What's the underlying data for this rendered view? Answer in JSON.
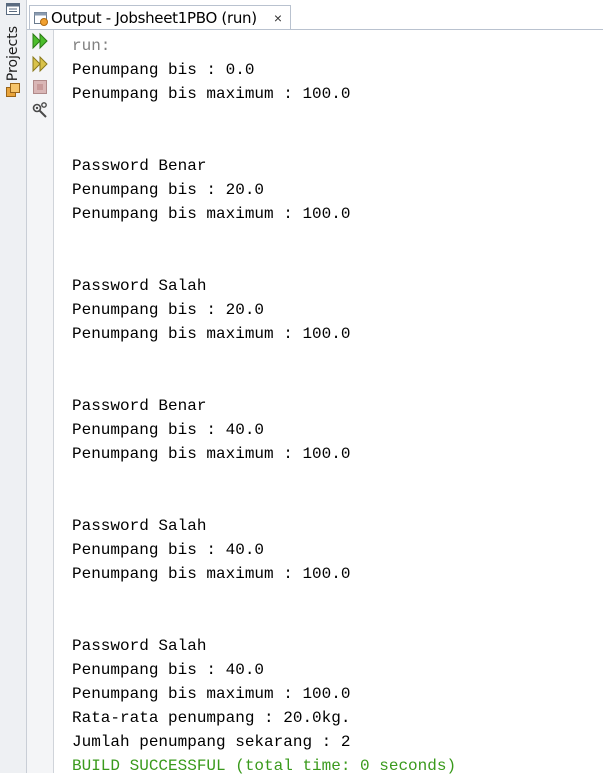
{
  "sidebar": {
    "projects_label": "Projects"
  },
  "tab": {
    "title": "Output - Jobsheet1PBO (run)",
    "close": "×"
  },
  "toolbar": {
    "buttons": [
      "rerun-icon",
      "rerun-with-options-icon",
      "stop-icon",
      "settings-icon"
    ]
  },
  "console": {
    "lines": [
      {
        "text": "run:",
        "style": "gray"
      },
      {
        "text": "Penumpang bis : 0.0",
        "style": "normal"
      },
      {
        "text": "Penumpang bis maximum : 100.0",
        "style": "normal"
      },
      {
        "text": "",
        "style": "normal"
      },
      {
        "text": "",
        "style": "normal"
      },
      {
        "text": "Password Benar",
        "style": "normal"
      },
      {
        "text": "Penumpang bis : 20.0",
        "style": "normal"
      },
      {
        "text": "Penumpang bis maximum : 100.0",
        "style": "normal"
      },
      {
        "text": "",
        "style": "normal"
      },
      {
        "text": "",
        "style": "normal"
      },
      {
        "text": "Password Salah",
        "style": "normal"
      },
      {
        "text": "Penumpang bis : 20.0",
        "style": "normal"
      },
      {
        "text": "Penumpang bis maximum : 100.0",
        "style": "normal"
      },
      {
        "text": "",
        "style": "normal"
      },
      {
        "text": "",
        "style": "normal"
      },
      {
        "text": "Password Benar",
        "style": "normal"
      },
      {
        "text": "Penumpang bis : 40.0",
        "style": "normal"
      },
      {
        "text": "Penumpang bis maximum : 100.0",
        "style": "normal"
      },
      {
        "text": "",
        "style": "normal"
      },
      {
        "text": "",
        "style": "normal"
      },
      {
        "text": "Password Salah",
        "style": "normal"
      },
      {
        "text": "Penumpang bis : 40.0",
        "style": "normal"
      },
      {
        "text": "Penumpang bis maximum : 100.0",
        "style": "normal"
      },
      {
        "text": "",
        "style": "normal"
      },
      {
        "text": "",
        "style": "normal"
      },
      {
        "text": "Password Salah",
        "style": "normal"
      },
      {
        "text": "Penumpang bis : 40.0",
        "style": "normal"
      },
      {
        "text": "Penumpang bis maximum : 100.0",
        "style": "normal"
      },
      {
        "text": "Rata-rata penumpang : 20.0kg.",
        "style": "normal"
      },
      {
        "text": "Jumlah penumpang sekarang : 2",
        "style": "normal"
      },
      {
        "text": "BUILD SUCCESSFUL (total time: 0 seconds)",
        "style": "green"
      }
    ]
  },
  "colors": {
    "build_success": "#3a9a1c",
    "run_label": "#808080"
  }
}
